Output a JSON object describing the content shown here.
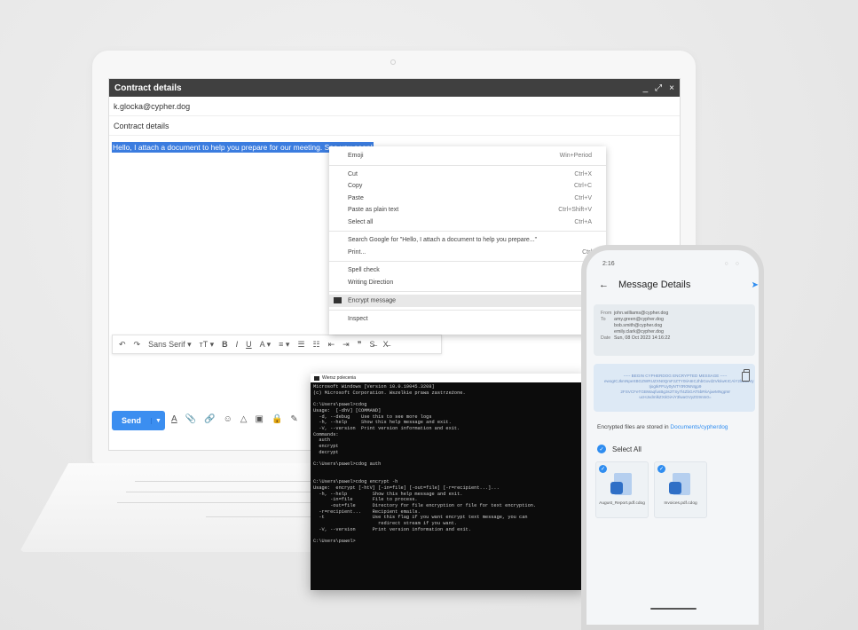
{
  "email": {
    "window_title": "Contract details",
    "window_controls": [
      "_",
      "⤢",
      "×"
    ],
    "to": "k.glocka@cypher.dog",
    "subject": "Contract details",
    "body_selected": "Hello, I attach a document to help you prepare for our meeting. See you soon!",
    "toolbar": [
      "↶",
      "↷",
      "Sans Serif ▾",
      "ᴛT ▾",
      "B",
      "I",
      "U",
      "A ▾",
      "≡ ▾",
      "☰",
      "☷",
      "⇤",
      "⇥",
      "❞",
      "S̶",
      "X̶"
    ],
    "send_label": "Send",
    "send_more": "▼",
    "bottom_icons": [
      "A",
      "📎",
      "🔗",
      "☺",
      "△",
      "▣",
      "🔒",
      "✎"
    ]
  },
  "context_menu": {
    "items": [
      {
        "label": "Emoji",
        "shortcut": "Win+Period"
      },
      {
        "sep": true
      },
      {
        "label": "Cut",
        "shortcut": "Ctrl+X"
      },
      {
        "label": "Copy",
        "shortcut": "Ctrl+C"
      },
      {
        "label": "Paste",
        "shortcut": "Ctrl+V"
      },
      {
        "label": "Paste as plain text",
        "shortcut": "Ctrl+Shift+V"
      },
      {
        "label": "Select all",
        "shortcut": "Ctrl+A"
      },
      {
        "sep": true
      },
      {
        "label": "Search Google for \"Hello, I attach a document to help you prepare...\"",
        "shortcut": ""
      },
      {
        "label": "Print...",
        "shortcut": "Ctrl"
      },
      {
        "sep": true
      },
      {
        "label": "Spell check",
        "shortcut": ""
      },
      {
        "label": "Writing Direction",
        "shortcut": ""
      },
      {
        "sep": true
      },
      {
        "label": "Encrypt message",
        "shortcut": "",
        "highlight": true
      },
      {
        "sep": true
      },
      {
        "label": "Inspect",
        "shortcut": ""
      }
    ]
  },
  "terminal": {
    "title": "Wiersz polecenia",
    "text": "Microsoft Windows [Version 10.0.19045.3208]\n(c) Microsoft Corporation. Wszelkie prawa zastrzeżone.\n\nC:\\Users\\pawel>cdog\nUsage:  [-dhV] [COMMAND]\n  -d, --debug    Use this to see more logs\n  -h, --help     Show this help message and exit.\n  -V, --version  Print version information and exit.\nCommands:\n  auth\n  encrypt\n  decrypt\n\nC:\\Users\\pawel>cdog auth\n\n\nC:\\Users\\pawel>cdog encrypt -h\nUsage:  encrypt [-htV] [-in=file] [-out=file] [-r=recipient...]...\n  -h, --help         Show this help message and exit.\n      -in=file       File to process.\n      -out=file      Directory for file encryption or file for text encryption.\n  -r=recipient...    Recipient emails.\n  -t                 Use this flag if you want encrypt text message, you can\n                       redirect stream if you want.\n  -V, --version      Print version information and exit.\n\nC:\\Users\\pawel>"
  },
  "phone": {
    "time": "2:16",
    "header_title": "Message Details",
    "from_label": "From",
    "from": "john.williams@cypher.dog",
    "to_label": "To",
    "to": [
      "amy.green@cypher.dog",
      "bob.smith@cypher.dog",
      "emily.clark@cypher.dog"
    ],
    "date_label": "Date",
    "date": "Sun, 08 Oct 2023 14:16:22",
    "encrypted_text": "----- BEGIN CYPHERDOG ENCRYPTED MESSAGE ----- ewogICJkmNpeXBGZWRUZXN0QmFzZTY0IiA6ICJhbGxvd2VkIiwKICAiY2lwaGVy IjogIkFFUy0yNTYtR0NNIgp9 2FSVCFeTGBWaqfusBg3s2TSy7l4ZbGAT5bRkAjaeMNgpW ucHJvdmlkZXIiOiAiY3lwaGVyZG9nIn0=",
    "stored_text": "Encrypted files are stored in",
    "stored_link": "Documents/cypherdog",
    "select_all": "Select All",
    "files": [
      "August_Report.pdf.cdog",
      "Invoices.pdf.cdog"
    ]
  }
}
